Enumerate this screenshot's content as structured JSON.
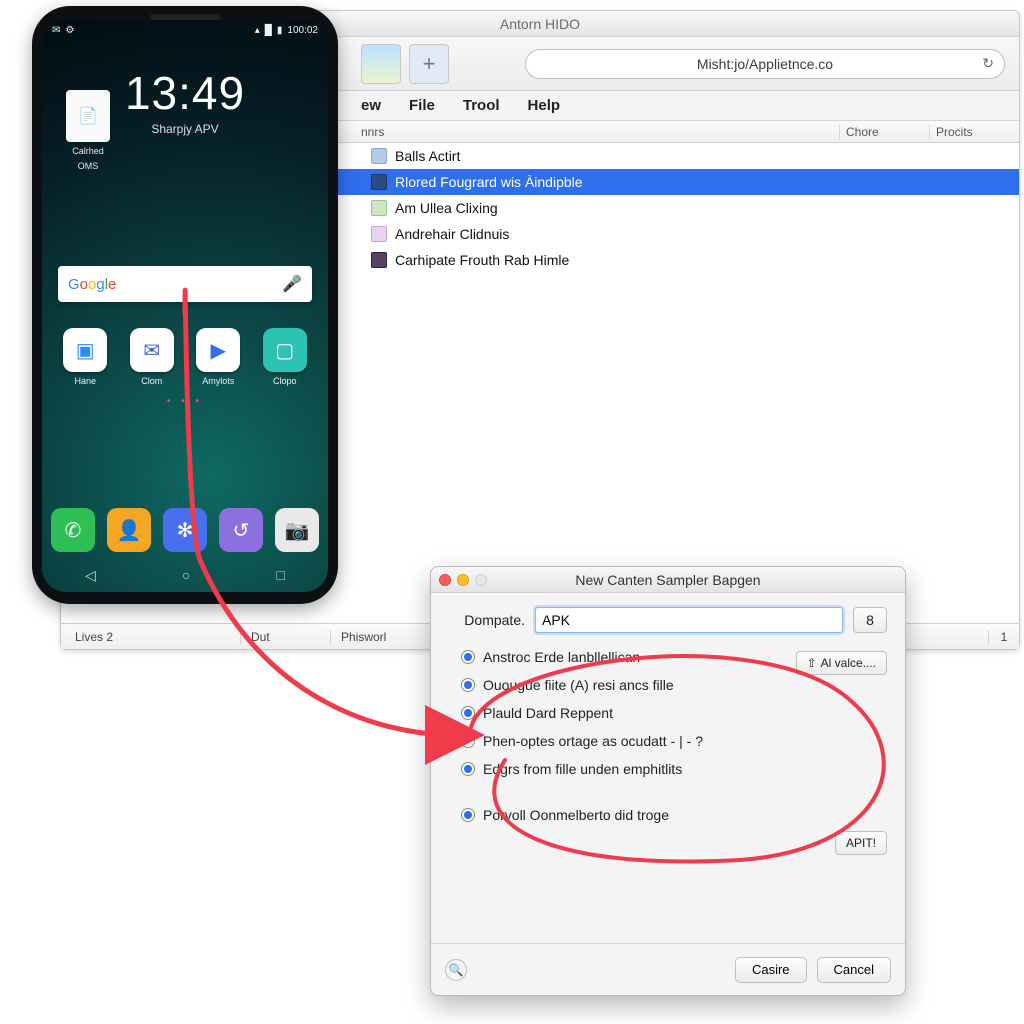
{
  "app_window": {
    "title": "Antorn HIDO",
    "url": "Misht:jo/Applietnce.co",
    "menubar": [
      "ew",
      "File",
      "Trool",
      "Help"
    ],
    "columns": {
      "c1": "nnrs",
      "c2": "Chore",
      "c3": "Procits"
    },
    "rows": [
      {
        "label": "Balls Actirt",
        "selected": false
      },
      {
        "label": "Rlored Fougrard wis Àindipble",
        "selected": true
      },
      {
        "label": "Am Ullea Clixing",
        "selected": false
      },
      {
        "label": "Andrehair Clidnuis",
        "selected": false
      },
      {
        "label": "Carhipate Frouth Rab Himle",
        "selected": false
      }
    ],
    "bottom": {
      "a": "Lives 2",
      "b": "Dut",
      "c": "Phisworl",
      "d": "1"
    }
  },
  "phone": {
    "status_time": "100:02",
    "clock": "13:49",
    "clock_sub": "Sharpjy APV",
    "widget1": "Calrhed",
    "widget2": "OMS",
    "search_logo": "Google",
    "apps": [
      "Hane",
      "Clom",
      "Amylots",
      "Clopo"
    ],
    "nav": [
      "◁",
      "○",
      "□"
    ]
  },
  "dialog": {
    "title": "New Canten Sampler Bapgen",
    "field_label": "Dompate.",
    "field_value": "APK",
    "stepper": "8",
    "options": [
      {
        "label": "Anstroc Erde lanbllellican",
        "checked": true
      },
      {
        "label": "Ouougue fiite (A) resi ancs fille",
        "checked": true
      },
      {
        "label": "Plauld Dard Reppent",
        "checked": true
      },
      {
        "label": "Phen-optes ortage as ocudatt - | - ?",
        "checked": false
      },
      {
        "label": "Edgrs from fille unden emphitlits",
        "checked": true
      },
      {
        "label": "Porvoll Oonmelberto did troge",
        "checked": true
      }
    ],
    "side_btn_a": "Al valce....",
    "side_btn_b": "APIT!",
    "btn_ok": "Casire",
    "btn_cancel": "Cancel"
  }
}
